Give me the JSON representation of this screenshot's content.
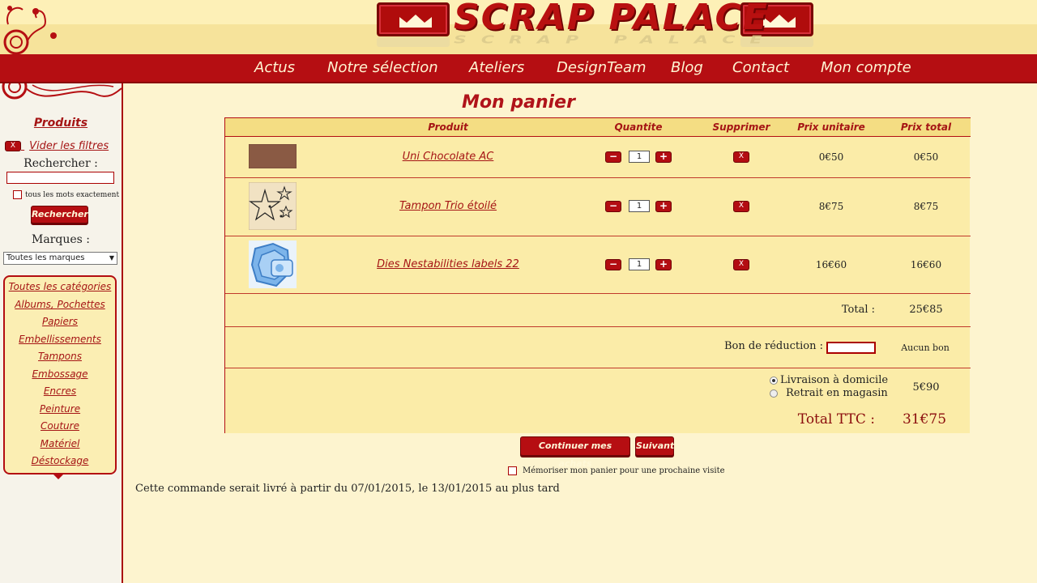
{
  "header": {
    "logo_text": "SCRAP PALACE",
    "nav": [
      "Actus",
      "Notre sélection",
      "Ateliers",
      "DesignTeam",
      "Blog",
      "Contact",
      "Mon compte"
    ]
  },
  "sidebar": {
    "products_title": "Produits",
    "clear_filters": "Vider les filtres",
    "clear_icon": "X",
    "search_label": "Rechercher :",
    "search_value": "",
    "exact_label": "tous les mots exactement",
    "search_button": "Rechercher",
    "brands_label": "Marques :",
    "brand_selected": "Toutes les marques",
    "categories": [
      "Toutes les catégories",
      "Albums, Pochettes",
      "Papiers",
      "Embellissements",
      "Tampons",
      "Embossage",
      "Encres",
      "Peinture",
      "Couture",
      "Matériel",
      "Déstockage"
    ]
  },
  "cart": {
    "title": "Mon panier",
    "columns": {
      "product": "Produit",
      "quantity": "Quantite",
      "delete": "Supprimer",
      "unit_price": "Prix unitaire",
      "total_price": "Prix total"
    },
    "items": [
      {
        "name": "Uni Chocolate AC",
        "qty": "1",
        "unit": "0€50",
        "total": "0€50",
        "thumb": "chocolate-swatch"
      },
      {
        "name": "Tampon Trio étoilé",
        "qty": "1",
        "unit": "8€75",
        "total": "8€75",
        "thumb": "star-stamp"
      },
      {
        "name": "Dies Nestabilities labels 22",
        "qty": "1",
        "unit": "16€60",
        "total": "16€60",
        "thumb": "blue-dies"
      }
    ],
    "minus": "−",
    "plus": "+",
    "delete_icon": "X",
    "total_label": "Total :",
    "total_value": "25€85",
    "coupon_label": "Bon de réduction :",
    "coupon_value": "",
    "coupon_status": "Aucun bon",
    "shipping_home": "Livraison à domicile",
    "shipping_store": "Retrait en magasin",
    "shipping_price": "5€90",
    "ttc_label": "Total TTC :",
    "ttc_value": "31€75"
  },
  "actions": {
    "continue": "Continuer mes achats",
    "next": "Suivant",
    "remember": "Mémoriser mon panier pour une prochaine visite",
    "delivery_note": "Cette commande serait livré à partir du 07/01/2015, le 13/01/2015 au plus tard"
  },
  "colors": {
    "brand_red": "#b50e12",
    "cream": "#fdf4cf",
    "table_bg": "#fbeca8"
  }
}
